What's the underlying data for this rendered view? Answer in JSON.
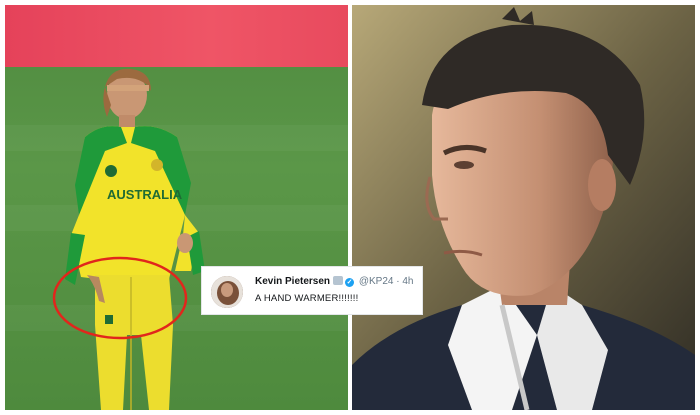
{
  "jersey_text": "AUSTRALIA",
  "tweet": {
    "name": "Kevin Pietersen",
    "emoji_icon": "raised-hands-icon",
    "verified_icon": "verified-badge-icon",
    "handle": "@KP24",
    "separator": "·",
    "time": "4h",
    "text": "A HAND WARMER!!!!!!!"
  },
  "colors": {
    "circle_annotation": "#e1261c",
    "kit_yellow": "#f2e32a",
    "kit_green": "#1f9a3a",
    "twitter_blue": "#1da1f2"
  }
}
